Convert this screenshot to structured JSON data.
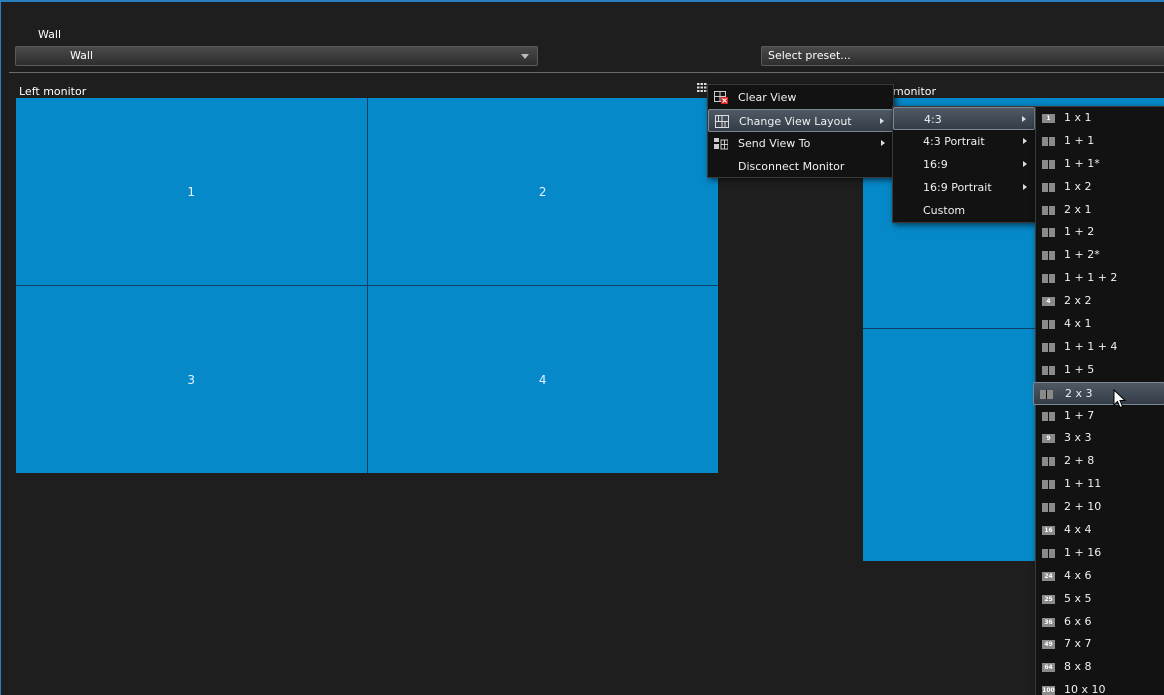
{
  "header": {
    "wall_label": "Wall",
    "wall_select_value": "Wall",
    "preset_placeholder": "Select preset..."
  },
  "monitors": {
    "left": {
      "label": "Left monitor",
      "tiles": [
        "1",
        "2",
        "3",
        "4"
      ]
    },
    "right": {
      "label": "monitor"
    }
  },
  "context_menu": {
    "items": [
      {
        "label": "Clear View",
        "icon": "clear-view-icon"
      },
      {
        "label": "Change View Layout",
        "icon": "change-layout-icon"
      },
      {
        "label": "Send View To",
        "icon": "send-view-icon"
      },
      {
        "label": "Disconnect Monitor"
      }
    ]
  },
  "aspect_menu": {
    "items": [
      "4:3",
      "4:3 Portrait",
      "16:9",
      "16:9 Portrait",
      "Custom"
    ]
  },
  "layout_menu": {
    "items": [
      {
        "label": "1 x 1",
        "badge": "1"
      },
      {
        "label": "1 + 1",
        "badge": ""
      },
      {
        "label": "1 + 1*",
        "badge": ""
      },
      {
        "label": "1 x 2",
        "badge": ""
      },
      {
        "label": "2 x 1",
        "badge": ""
      },
      {
        "label": "1 + 2",
        "badge": ""
      },
      {
        "label": "1 + 2*",
        "badge": ""
      },
      {
        "label": "1 + 1 + 2",
        "badge": ""
      },
      {
        "label": "2 x 2",
        "badge": "4"
      },
      {
        "label": "4 x 1",
        "badge": ""
      },
      {
        "label": "1 + 1 + 4",
        "badge": ""
      },
      {
        "label": "1 + 5",
        "badge": ""
      },
      {
        "label": "2 x 3",
        "badge": ""
      },
      {
        "label": "1 + 7",
        "badge": ""
      },
      {
        "label": "3 x 3",
        "badge": "9"
      },
      {
        "label": "2 + 8",
        "badge": ""
      },
      {
        "label": "1 + 11",
        "badge": ""
      },
      {
        "label": "2 + 10",
        "badge": ""
      },
      {
        "label": "4 x 4",
        "badge": "16"
      },
      {
        "label": "1 + 16",
        "badge": ""
      },
      {
        "label": "4 x 6",
        "badge": "24"
      },
      {
        "label": "5 x 5",
        "badge": "25"
      },
      {
        "label": "6 x 6",
        "badge": "36"
      },
      {
        "label": "7 x 7",
        "badge": "49"
      },
      {
        "label": "8 x 8",
        "badge": "64"
      },
      {
        "label": "10 x 10",
        "badge": "100"
      }
    ]
  },
  "colors": {
    "accent": "#2a7fc0",
    "tile": "#0689c9",
    "background": "#1e1e1e"
  }
}
